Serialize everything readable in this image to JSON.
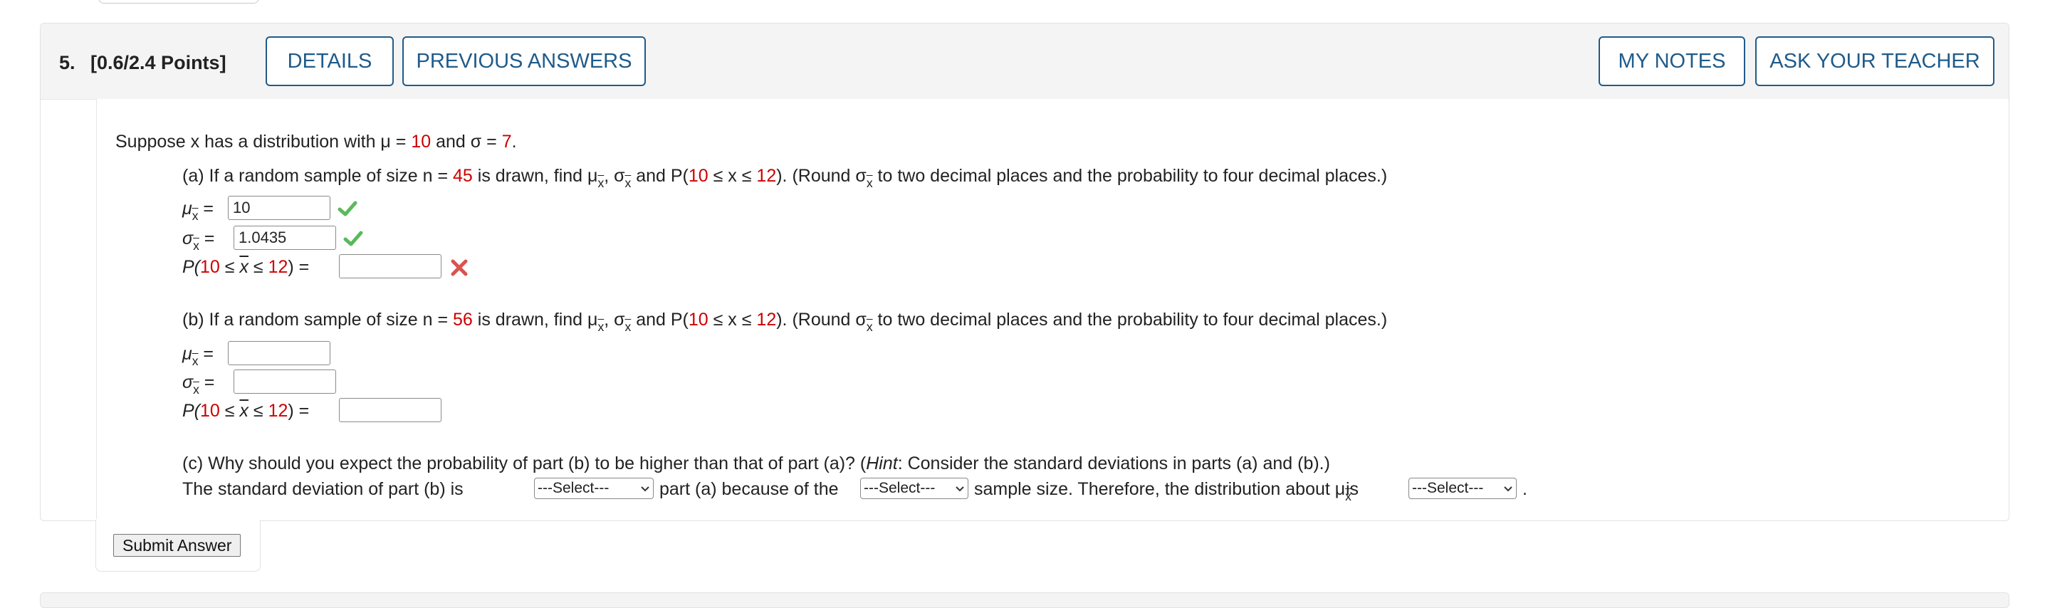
{
  "question": {
    "number": "5.",
    "points": "[0.6/2.4 Points]",
    "buttons": {
      "details": "DETAILS",
      "previous_answers": "PREVIOUS ANSWERS",
      "my_notes": "MY NOTES",
      "ask_teacher": "ASK YOUR TEACHER"
    },
    "intro": {
      "prefix": "Suppose x has a distribution with μ = ",
      "mu": "10",
      "mid": " and σ = ",
      "sigma": "7",
      "suffix": "."
    },
    "part_a": {
      "text_1": "(a) If a random sample of size n = ",
      "n": "45",
      "text_2": " is drawn, find μ",
      "text_3": ", σ",
      "text_4": " and P(",
      "lo": "10",
      "text_5": " ≤ x ≤ ",
      "hi": "12",
      "text_6": "). (Round σ",
      "text_7": " to two decimal places and the probability to four decimal places.)",
      "mu_answer": "10",
      "sigma_answer": "1.0435",
      "prob_answer": ""
    },
    "part_b": {
      "text_1": "(b) If a random sample of size n = ",
      "n": "56",
      "text_2": " is drawn, find μ",
      "text_3": ", σ",
      "text_4": " and P(",
      "lo": "10",
      "text_5": " ≤ x ≤ ",
      "hi": "12",
      "text_6": "). (Round σ",
      "text_7": " to two decimal places and the probability to four decimal places.)",
      "mu_answer": "",
      "sigma_answer": "",
      "prob_answer": ""
    },
    "part_c": {
      "question_1": "(c) Why should you expect the probability of part (b) to be higher than that of part (a)? (",
      "hint_word": "Hint",
      "question_2": ": Consider the standard deviations in parts (a) and (b).)",
      "line_1": "The standard deviation of part (b) is",
      "line_2": "part (a) because of the",
      "line_3": "sample size. Therefore, the distribution about μ",
      "line_4": "is",
      "line_5": ".",
      "select_1": "---Select---",
      "select_2": "---Select---",
      "select_3": "---Select---"
    },
    "labels": {
      "mu": "μ",
      "sigma": "σ",
      "x": "x",
      "eq": " =",
      "p_open": "P(",
      "le": " ≤ ",
      "p_close": ") ="
    },
    "submit": "Submit Answer",
    "colors": {
      "accent": "#1f5b8a",
      "highlight": "#cc0000",
      "correct": "#5cb85c",
      "incorrect": "#d9534f"
    },
    "icons": {
      "correct": "check-icon",
      "incorrect": "cross-icon",
      "dropdown": "chevron-down-icon"
    }
  }
}
